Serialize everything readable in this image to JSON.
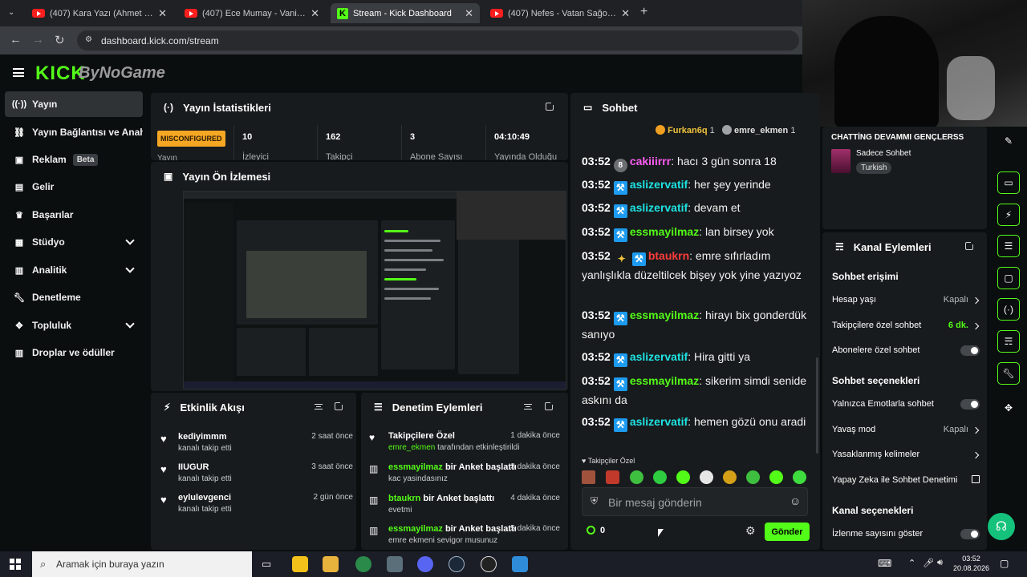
{
  "browser": {
    "tabs": [
      {
        "title": "(407) Kara Yazı (Ahmet Kaya) - Y",
        "icon": "youtube-icon",
        "active": false
      },
      {
        "title": "(407) Ece Mumay - Vanilya - Yo",
        "icon": "youtube-icon",
        "active": false
      },
      {
        "title": "Stream - Kick Dashboard",
        "icon": "kick-icon",
        "active": true
      },
      {
        "title": "(407) Nefes - Vatan Sağolsun | E",
        "icon": "youtube-icon",
        "active": false
      }
    ],
    "url": "dashboard.kick.com/stream"
  },
  "header": {
    "logo": "KICK",
    "channel_logo": "ByNoGame"
  },
  "sidebar": {
    "items": [
      {
        "label": "Yayın",
        "icon": "broadcast-icon",
        "active": true
      },
      {
        "label": "Yayın Bağlantısı ve Anahtarı",
        "icon": "link-icon"
      },
      {
        "label": "Reklam",
        "icon": "ad-icon",
        "badge": "Beta"
      },
      {
        "label": "Gelir",
        "icon": "revenue-icon"
      },
      {
        "label": "Başarılar",
        "icon": "trophy-icon"
      },
      {
        "label": "Stüdyo",
        "icon": "studio-icon",
        "expand": true
      },
      {
        "label": "Analitik",
        "icon": "analytics-icon",
        "expand": true
      },
      {
        "label": "Denetleme",
        "icon": "wrench-icon"
      },
      {
        "label": "Topluluk",
        "icon": "community-icon",
        "expand": true
      },
      {
        "label": "Droplar ve ödüller",
        "icon": "drops-icon"
      }
    ]
  },
  "stats": {
    "title": "Yayın İstatistikleri",
    "status_badge": "MISCONFIGURED",
    "status_sub": "Yayın",
    "items": [
      {
        "value": "10",
        "label": "İzleyici"
      },
      {
        "value": "162",
        "label": "Takipçi"
      },
      {
        "value": "3",
        "label": "Abone Sayısı"
      },
      {
        "value": "04:10:49",
        "label": "Yayında Olduğu"
      }
    ]
  },
  "preview": {
    "title": "Yayın Ön İzlemesi"
  },
  "activity": {
    "title": "Etkinlik Akışı",
    "items": [
      {
        "name": "kediyimmm",
        "action": "kanalı takip etti",
        "time": "2 saat önce"
      },
      {
        "name": "IIUGUR",
        "action": "kanalı takip etti",
        "time": "3 saat önce"
      },
      {
        "name": "eylulevgenci",
        "action": "kanalı takip etti",
        "time": "2 gün önce"
      }
    ]
  },
  "moderation": {
    "title": "Denetim Eylemleri",
    "items": [
      {
        "user": "",
        "title": "Takipçilere Özel",
        "sub_user": "emre_ekmen",
        "sub": " tarafından etkinleştirildi",
        "time": "1 dakika önce",
        "icon": "heart-icon"
      },
      {
        "user": "essmayilmaz",
        "title": " bir Anket başlattı",
        "sub_user": "",
        "sub": "kac yasindasınız",
        "time": "3 dakika önce",
        "icon": "poll-icon"
      },
      {
        "user": "btaukrn",
        "title": " bir Anket başlattı",
        "sub_user": "",
        "sub": "evetmi",
        "time": "4 dakika önce",
        "icon": "poll-icon"
      },
      {
        "user": "essmayilmaz",
        "title": " bir Anket başlattı",
        "sub_user": "",
        "sub": "emre ekmeni sevigor musunuz",
        "time": "5 dakika önce",
        "icon": "poll-icon"
      }
    ]
  },
  "chat": {
    "title": "Sohbet",
    "top_users": [
      {
        "name": "Furkan6q",
        "count": "1"
      },
      {
        "name": "emre_ekmen",
        "count": "1"
      }
    ],
    "messages": [
      {
        "time": "03:52",
        "user": "cakiiirrr",
        "text": ": hacı 3 gün sonra 18",
        "color": "#ff5cf5",
        "badge": "8"
      },
      {
        "time": "03:52",
        "user": "aslizervatif",
        "text": ": her şey yerinde",
        "color": "#1ee3e3",
        "badge": "⚒"
      },
      {
        "time": "03:52",
        "user": "aslizervatif",
        "text": ": devam et",
        "color": "#1ee3e3",
        "badge": "⚒"
      },
      {
        "time": "03:52",
        "user": "essmayilmaz",
        "text": ": lan birsey yok",
        "color": "#53fc18",
        "badge": "⚒"
      },
      {
        "time": "03:52",
        "user": "btaukrn",
        "text": ": emre sıfırladım yanlışlıkla düzeltilcek bişey yok yine yazıyoz",
        "color": "#ff3d3d",
        "badge": "⚒"
      },
      {
        "time": "03:52",
        "user": "essmayilmaz",
        "text": ": hirayı bix gonderdük sanıyo",
        "color": "#53fc18",
        "badge": "⚒"
      },
      {
        "time": "03:52",
        "user": "aslizervatif",
        "text": ": Hira gitti ya",
        "color": "#1ee3e3",
        "badge": "⚒"
      },
      {
        "time": "03:52",
        "user": "essmayilmaz",
        "text": ": sikerim simdi senide askını da",
        "color": "#53fc18",
        "badge": "⚒"
      },
      {
        "time": "03:52",
        "user": "aslizervatif",
        "text": ": hemen gözü onu aradi",
        "color": "#1ee3e3",
        "badge": "⚒"
      }
    ],
    "pinned_label": "Takipçiler Özel",
    "input_placeholder": "Bir mesaj gönderin",
    "points": "0",
    "send_label": "Gönder"
  },
  "stream_info": {
    "title": "CHATTİNG DEVAMMI GENÇLERSS",
    "category": "Sadece Sohbet",
    "tag": "Turkish"
  },
  "channel_actions": {
    "title": "Kanal Eylemleri",
    "sections": [
      {
        "heading": "Sohbet erişimi"
      },
      {
        "heading": "Sohbet seçenekleri"
      },
      {
        "heading": "Kanal seçenekleri"
      }
    ],
    "rows": [
      {
        "label": "Hesap yaşı",
        "value": "Kapalı"
      },
      {
        "label": "Takipçilere özel sohbet",
        "value": "6 dk."
      },
      {
        "label": "Abonelere özel sohbet",
        "value": ""
      },
      {
        "label": "Yalnızca Emotlarla sohbet",
        "value": ""
      },
      {
        "label": "Yavaş mod",
        "value": "Kapalı"
      },
      {
        "label": "Yasaklanmış kelimeler",
        "value": ""
      },
      {
        "label": "Yapay Zeka ile Sohbet Denetimi",
        "value": ""
      },
      {
        "label": "İzlenme sayısını göster",
        "value": ""
      }
    ]
  },
  "taskbar": {
    "search_placeholder": "Aramak için buraya yazın",
    "time": "03:52",
    "date": "20.08.2026"
  }
}
